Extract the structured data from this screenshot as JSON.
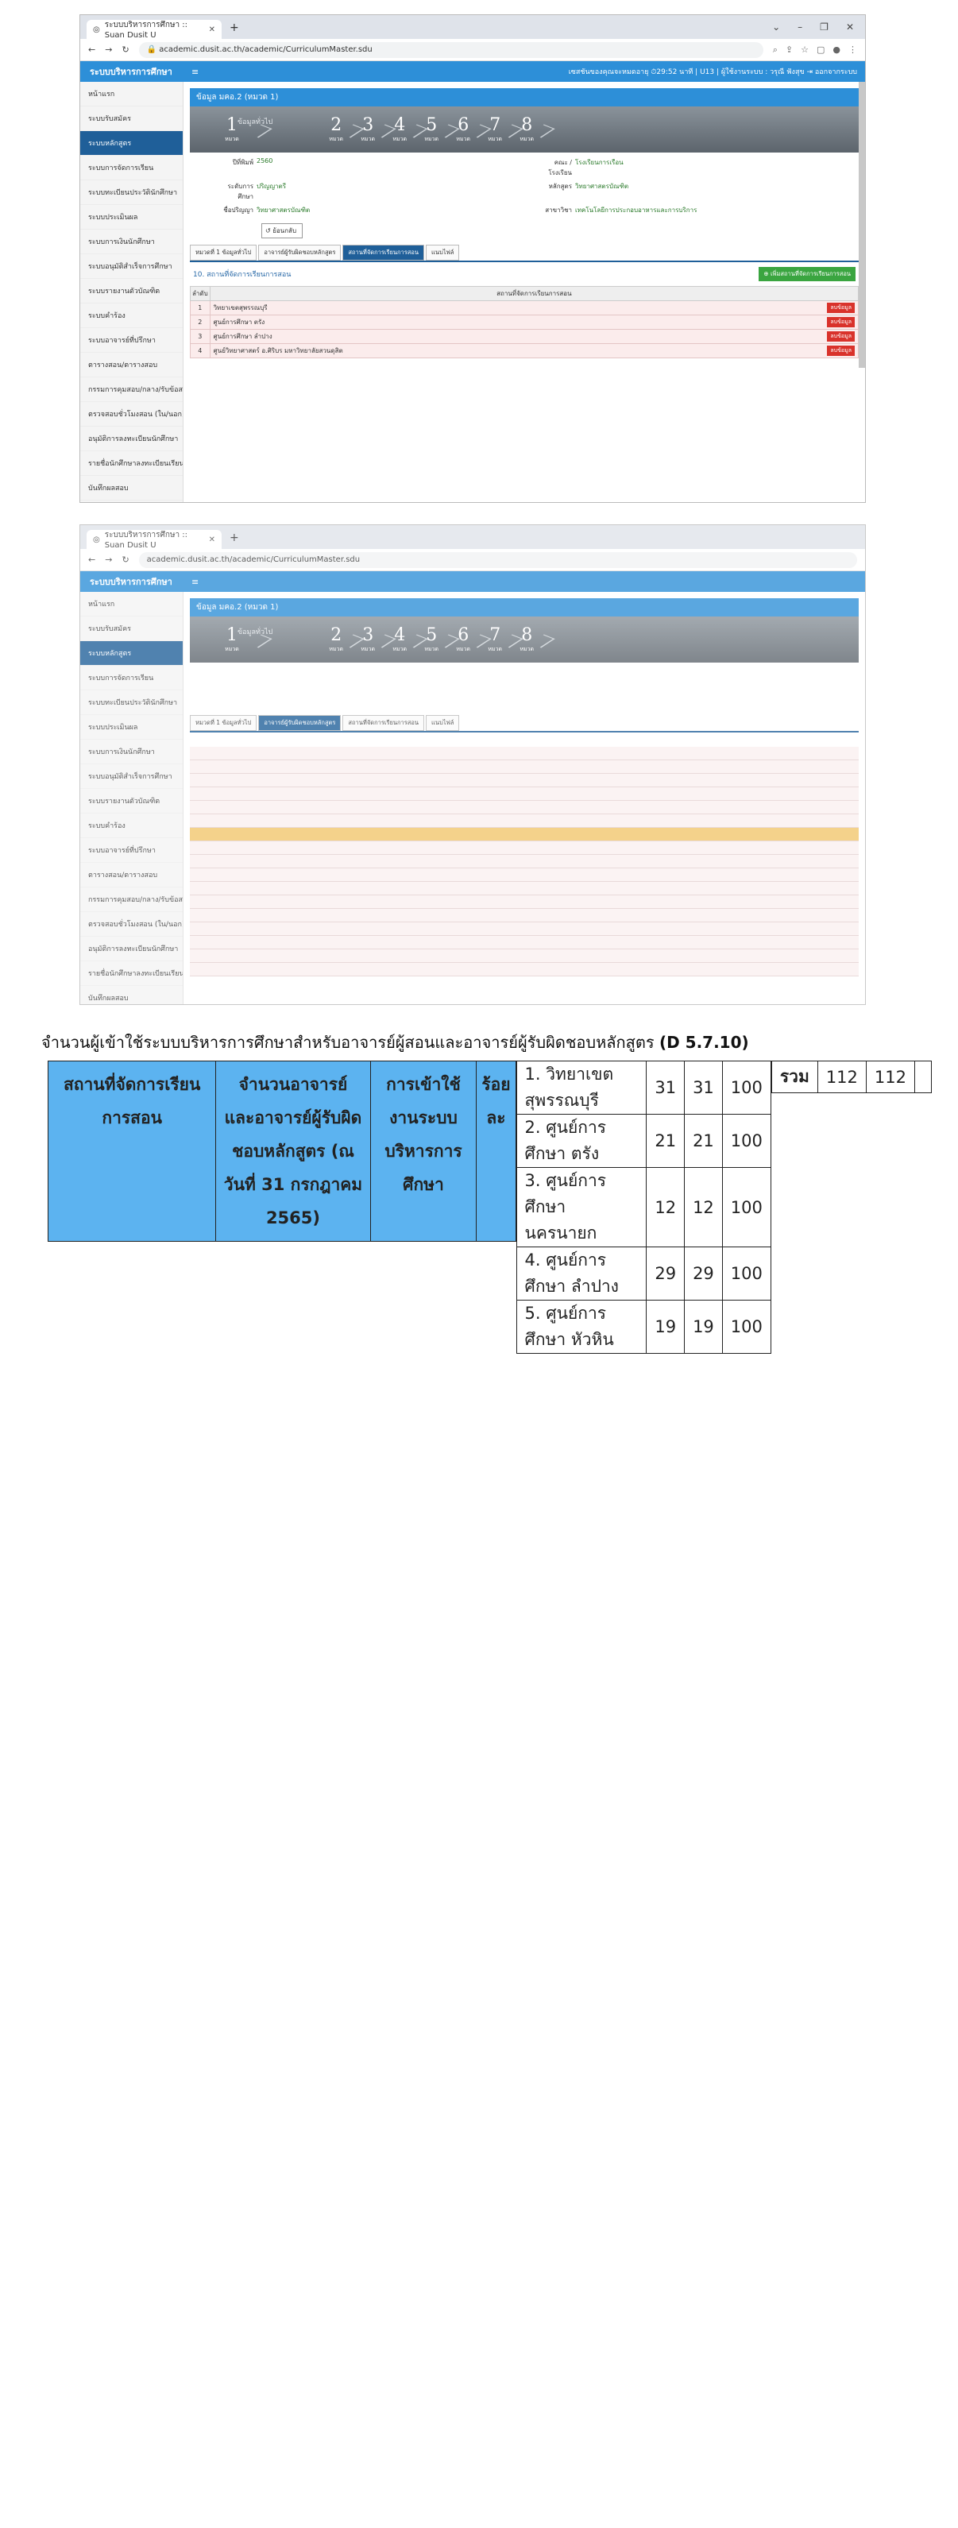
{
  "browser": {
    "tab_title": "ระบบบริหารการศึกษา :: Suan Dusit U",
    "url": "academic.dusit.ac.th/academic/CurriculumMaster.sdu"
  },
  "app": {
    "title": "ระบบบริหารการศึกษา",
    "header_right": "เซสชันของคุณจะหมดอายุ ⏱29:52 นาที | U13 | ผู้ใช้งานระบบ : วรุณี ฟังสุข ⇥ ออกจากระบบ"
  },
  "sidebar": {
    "items": [
      "หน้าแรก",
      "ระบบรับสมัคร",
      "ระบบหลักสูตร",
      "ระบบการจัดการเรียน",
      "ระบบทะเบียนประวัตินักศึกษา",
      "ระบบประเมินผล",
      "ระบบการเงินนักศึกษา",
      "ระบบอนุมัติสำเร็จการศึกษา",
      "ระบบรายงานตัวบัณฑิต",
      "ระบบคำร้อง",
      "ระบบอาจารย์ที่ปรึกษา",
      "ตารางสอน/ตารางสอบ",
      "กรรมการคุมสอบ/กลาง/รับข้อสอบ",
      "ตรวจสอบชั่วโมงสอน (ใน/นอก)",
      "อนุมัติการลงทะเบียนนักศึกษา",
      "รายชื่อนักศึกษาลงทะเบียนเรียน",
      "บันทึกผลสอบ"
    ]
  },
  "panel": {
    "heading": "ข้อมูล มคอ.2 (หมวด 1)",
    "step_label": "ข้อมูลทั่วไป",
    "steps": [
      "1",
      "2",
      "3",
      "4",
      "5",
      "6",
      "7",
      "8"
    ],
    "step_caption": "หมวด",
    "info": {
      "year_label": "ปีที่พิมพ์",
      "year": "2560",
      "level_label": "ระดับการศึกษา",
      "level": "ปริญญาตรี",
      "name_label": "ชื่อปริญญา",
      "name": "วิทยาศาสตรบัณฑิต",
      "faculty_label": "คณะ / โรงเรียน",
      "faculty": "โรงเรียนการเรือน",
      "program_label": "หลักสูตร",
      "program": "วิทยาศาสตรบัณฑิต",
      "major_label": "สาขาวิชา",
      "major": "เทคโนโลยีการประกอบอาหารและการบริการ"
    },
    "back_button": "ย้อนกลับ",
    "tabs": [
      "หมวดที่ 1 ข้อมูลทั่วไป",
      "อาจารย์ผู้รับผิดชอบหลักสูตร",
      "สถานที่จัดการเรียนการสอน",
      "แนบไฟล์"
    ],
    "section_title": "10. สถานที่จัดการเรียนการสอน",
    "add_button": "เพิ่มสถานที่จัดการเรียนการสอน",
    "table_headers": [
      "ลำดับ",
      "สถานที่จัดการเรียนการสอน"
    ],
    "rows": [
      [
        "1",
        "วิทยาเขตสุพรรณบุรี"
      ],
      [
        "2",
        "ศูนย์การศึกษา ตรัง"
      ],
      [
        "3",
        "ศูนย์การศึกษา ลำปาง"
      ],
      [
        "4",
        "ศูนย์วิทยาศาสตร์ อ.ศิริบร มหาวิทยาลัยสวนดุสิต"
      ]
    ],
    "delete_label": "ลบข้อมูล"
  },
  "caption": {
    "text": "จำนวนผู้เข้าใช้ระบบบริหารการศึกษาสำหรับอาจารย์ผู้สอนและอาจารย์ผู้รับผิดชอบหลักสูตร",
    "ref": "(D 5.7.10)"
  },
  "summary_table": {
    "headers": [
      "สถานที่จัดการเรียนการสอน",
      "จำนวนอาจารย์ และอาจารย์ผู้รับผิดชอบหลักสูตร (ณ วันที่ 31 กรกฎาคม 2565)",
      "การเข้าใช้งานระบบบริหารการศึกษา",
      "ร้อยละ"
    ],
    "rows": [
      [
        "1. วิทยาเขตสุพรรณบุรี",
        "31",
        "31",
        "100"
      ],
      [
        "2. ศูนย์การศึกษา ตรัง",
        "21",
        "21",
        "100"
      ],
      [
        "3. ศูนย์การศึกษา นครนายก",
        "12",
        "12",
        "100"
      ],
      [
        "4. ศูนย์การศึกษา ลำปาง",
        "29",
        "29",
        "100"
      ],
      [
        "5. ศูนย์การศึกษา หัวหิน",
        "19",
        "19",
        "100"
      ]
    ],
    "total_label": "รวม",
    "total_teachers": "112",
    "total_access": "112",
    "total_percent": ""
  }
}
